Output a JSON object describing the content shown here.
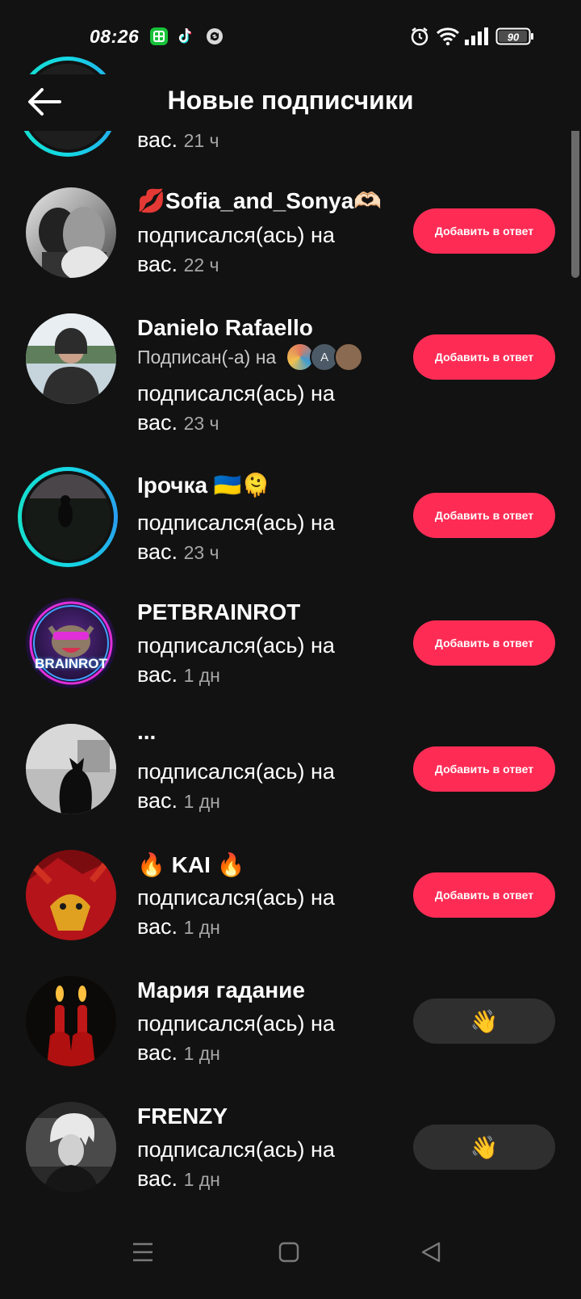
{
  "status_bar": {
    "time": "08:26",
    "notification_icons": [
      "messenger-app-icon",
      "tiktok-icon",
      "sync-icon"
    ],
    "system_icons": [
      "alarm-icon",
      "wifi-icon",
      "signal-icon",
      "battery-icon"
    ],
    "battery": "90"
  },
  "header": {
    "title": "Новые подписчики",
    "back_icon": "arrow-left-icon"
  },
  "partial_row": {
    "line2": "вас.",
    "time": "21 ч"
  },
  "followers": [
    {
      "name": "💋Sofia_and_Sonya🫶🏻",
      "line1": "подписался(ась) на",
      "line2": "вас.",
      "time": "22 ч",
      "button": "Добавить в ответ"
    },
    {
      "name": "Danielo Rafaello",
      "mutual_label": "Подписан(-а) на",
      "line1": "подписался(ась) на",
      "line2": "вас.",
      "time": "23 ч",
      "button": "Добавить в ответ"
    },
    {
      "name": "Ірочка 🇺🇦🫠",
      "line1": "подписался(ась) на",
      "line2": "вас.",
      "time": "23 ч",
      "button": "Добавить в ответ"
    },
    {
      "name": "PETBRAINROT",
      "line1": "подписался(ась) на",
      "line2": "вас.",
      "time": "1 дн",
      "button": "Добавить в ответ",
      "avatar_text": "BRAINROT"
    },
    {
      "name": "...",
      "line1": "подписался(ась) на",
      "line2": "вас.",
      "time": "1 дн",
      "button": "Добавить в ответ"
    },
    {
      "name": "🔥 KAI 🔥",
      "line1": "подписался(ась) на",
      "line2": "вас.",
      "time": "1 дн",
      "button": "Добавить в ответ"
    },
    {
      "name": "Мария  гадание",
      "line1": "подписался(ась) на",
      "line2": "вас.",
      "time": "1 дн",
      "button": "👋"
    },
    {
      "name": "FRENZY",
      "line1": "подписался(ась) на",
      "line2": "вас.",
      "time": "1 дн",
      "button": "👋"
    }
  ],
  "mutual_avatars": [
    "А"
  ],
  "colors": {
    "background": "#121212",
    "accent": "#fe2c55",
    "wave_button": "#2f2f2f",
    "secondary_text": "#a6a6a6",
    "story_ring": "#14d8e4"
  },
  "nav_bar": {
    "icons": [
      "menu-icon",
      "home-square-icon",
      "back-triangle-icon"
    ]
  }
}
